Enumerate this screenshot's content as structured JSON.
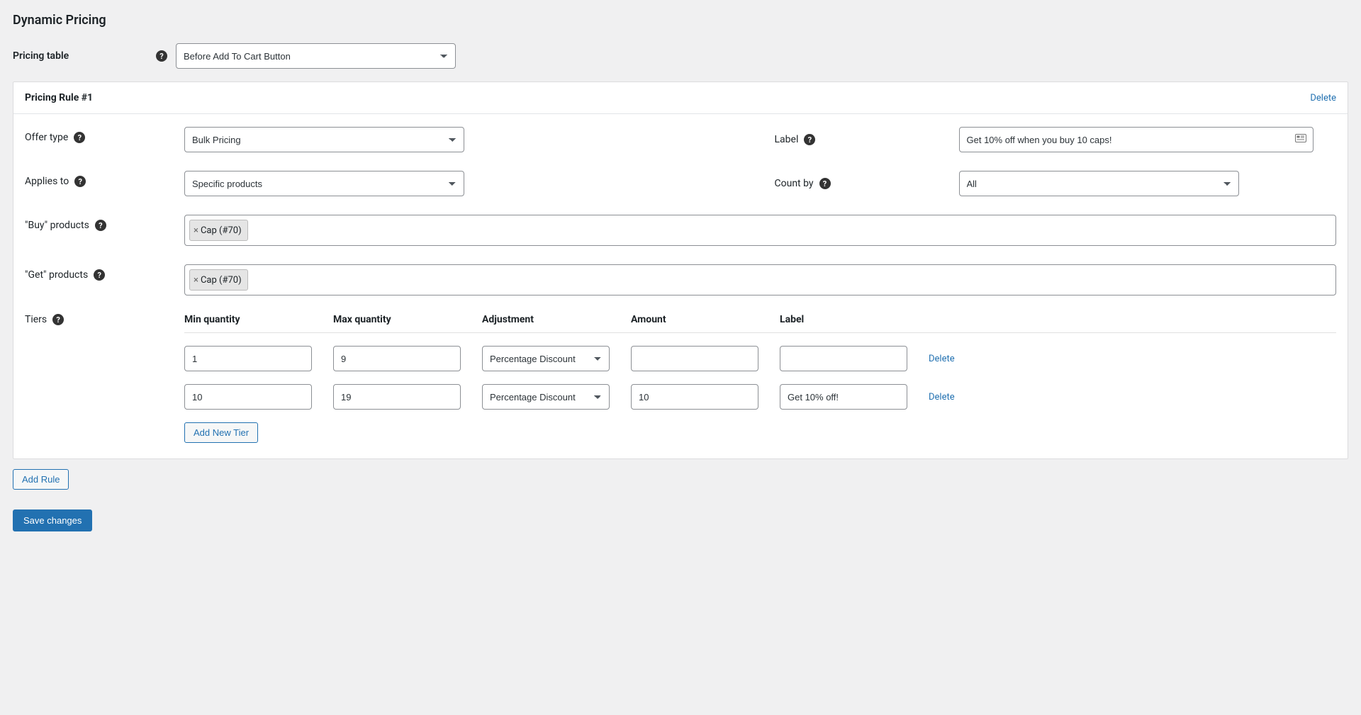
{
  "page": {
    "title": "Dynamic Pricing"
  },
  "top": {
    "pricing_table_label": "Pricing table",
    "pricing_table_value": "Before Add To Cart Button"
  },
  "rule": {
    "title": "Pricing Rule #1",
    "delete": "Delete",
    "offer_type_label": "Offer type",
    "offer_type_value": "Bulk Pricing",
    "label_label": "Label",
    "label_value": "Get 10% off when you buy 10 caps!",
    "applies_to_label": "Applies to",
    "applies_to_value": "Specific products",
    "count_by_label": "Count by",
    "count_by_value": "All",
    "buy_products_label": "\"Buy\" products",
    "buy_products_tags": [
      "Cap (#70)"
    ],
    "get_products_label": "\"Get\" products",
    "get_products_tags": [
      "Cap (#70)"
    ],
    "tiers_label": "Tiers",
    "tiers": {
      "headers": {
        "min": "Min quantity",
        "max": "Max quantity",
        "adj": "Adjustment",
        "amount": "Amount",
        "label": "Label"
      },
      "rows": [
        {
          "min": "1",
          "max": "9",
          "adj": "Percentage Discount",
          "amount": "",
          "label": "",
          "delete": "Delete"
        },
        {
          "min": "10",
          "max": "19",
          "adj": "Percentage Discount",
          "amount": "10",
          "label": "Get 10% off!",
          "delete": "Delete"
        }
      ],
      "add": "Add New Tier"
    }
  },
  "footer": {
    "add_rule": "Add Rule",
    "save": "Save changes"
  }
}
